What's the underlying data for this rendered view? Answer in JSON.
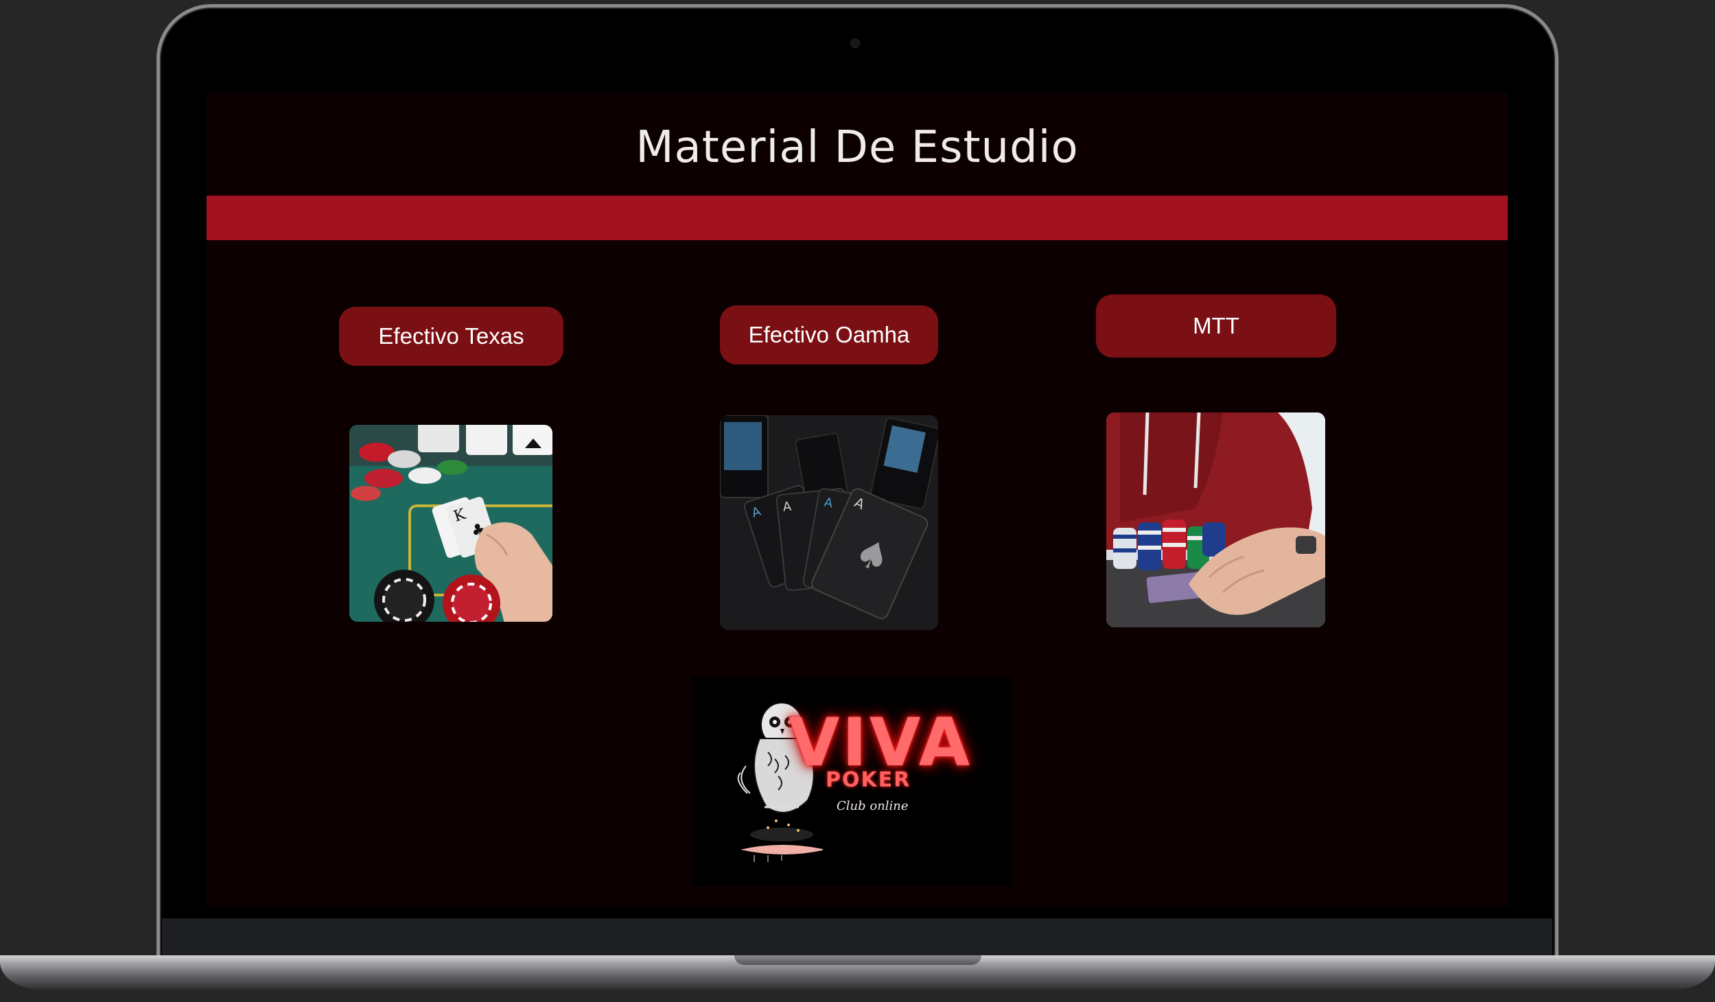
{
  "page": {
    "title": "Material De Estudio"
  },
  "categories": [
    {
      "label": "Efectivo Texas",
      "image": "poker-table-kings-photo"
    },
    {
      "label": "Efectivo Oamha",
      "image": "black-aces-cards-photo"
    },
    {
      "label": "MTT",
      "image": "player-with-chips-photo"
    }
  ],
  "logo": {
    "line1": "VIVA",
    "line2": "POKER",
    "line3": "Club online"
  },
  "colors": {
    "background": "#0c0001",
    "band": "#a31220",
    "button": "#7b1014",
    "title_text": "#f1ecec",
    "neon": "#ff5a5a"
  }
}
